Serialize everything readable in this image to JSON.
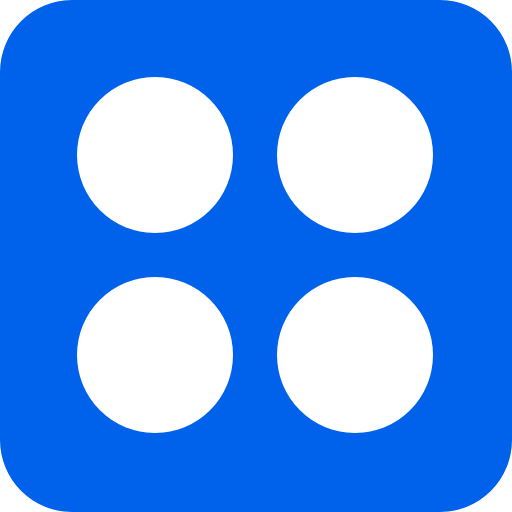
{
  "icon": {
    "name": "four-dots-grid-icon",
    "background_color": "#0062EA",
    "dot_color": "#FFFFFF",
    "dot_count": 4
  }
}
